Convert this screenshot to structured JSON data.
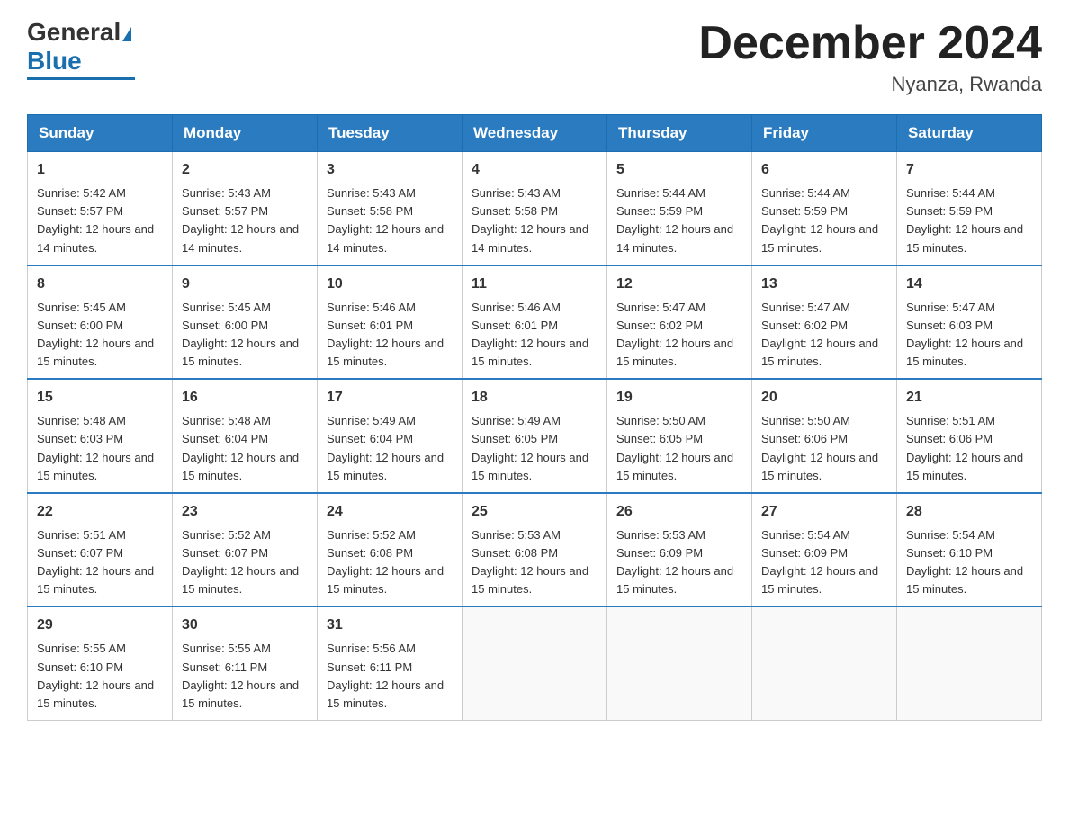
{
  "logo": {
    "general": "General",
    "blue": "Blue"
  },
  "header": {
    "month_year": "December 2024",
    "location": "Nyanza, Rwanda"
  },
  "days_of_week": [
    "Sunday",
    "Monday",
    "Tuesday",
    "Wednesday",
    "Thursday",
    "Friday",
    "Saturday"
  ],
  "weeks": [
    [
      {
        "day": "1",
        "sunrise": "5:42 AM",
        "sunset": "5:57 PM",
        "daylight": "12 hours and 14 minutes."
      },
      {
        "day": "2",
        "sunrise": "5:43 AM",
        "sunset": "5:57 PM",
        "daylight": "12 hours and 14 minutes."
      },
      {
        "day": "3",
        "sunrise": "5:43 AM",
        "sunset": "5:58 PM",
        "daylight": "12 hours and 14 minutes."
      },
      {
        "day": "4",
        "sunrise": "5:43 AM",
        "sunset": "5:58 PM",
        "daylight": "12 hours and 14 minutes."
      },
      {
        "day": "5",
        "sunrise": "5:44 AM",
        "sunset": "5:59 PM",
        "daylight": "12 hours and 14 minutes."
      },
      {
        "day": "6",
        "sunrise": "5:44 AM",
        "sunset": "5:59 PM",
        "daylight": "12 hours and 15 minutes."
      },
      {
        "day": "7",
        "sunrise": "5:44 AM",
        "sunset": "5:59 PM",
        "daylight": "12 hours and 15 minutes."
      }
    ],
    [
      {
        "day": "8",
        "sunrise": "5:45 AM",
        "sunset": "6:00 PM",
        "daylight": "12 hours and 15 minutes."
      },
      {
        "day": "9",
        "sunrise": "5:45 AM",
        "sunset": "6:00 PM",
        "daylight": "12 hours and 15 minutes."
      },
      {
        "day": "10",
        "sunrise": "5:46 AM",
        "sunset": "6:01 PM",
        "daylight": "12 hours and 15 minutes."
      },
      {
        "day": "11",
        "sunrise": "5:46 AM",
        "sunset": "6:01 PM",
        "daylight": "12 hours and 15 minutes."
      },
      {
        "day": "12",
        "sunrise": "5:47 AM",
        "sunset": "6:02 PM",
        "daylight": "12 hours and 15 minutes."
      },
      {
        "day": "13",
        "sunrise": "5:47 AM",
        "sunset": "6:02 PM",
        "daylight": "12 hours and 15 minutes."
      },
      {
        "day": "14",
        "sunrise": "5:47 AM",
        "sunset": "6:03 PM",
        "daylight": "12 hours and 15 minutes."
      }
    ],
    [
      {
        "day": "15",
        "sunrise": "5:48 AM",
        "sunset": "6:03 PM",
        "daylight": "12 hours and 15 minutes."
      },
      {
        "day": "16",
        "sunrise": "5:48 AM",
        "sunset": "6:04 PM",
        "daylight": "12 hours and 15 minutes."
      },
      {
        "day": "17",
        "sunrise": "5:49 AM",
        "sunset": "6:04 PM",
        "daylight": "12 hours and 15 minutes."
      },
      {
        "day": "18",
        "sunrise": "5:49 AM",
        "sunset": "6:05 PM",
        "daylight": "12 hours and 15 minutes."
      },
      {
        "day": "19",
        "sunrise": "5:50 AM",
        "sunset": "6:05 PM",
        "daylight": "12 hours and 15 minutes."
      },
      {
        "day": "20",
        "sunrise": "5:50 AM",
        "sunset": "6:06 PM",
        "daylight": "12 hours and 15 minutes."
      },
      {
        "day": "21",
        "sunrise": "5:51 AM",
        "sunset": "6:06 PM",
        "daylight": "12 hours and 15 minutes."
      }
    ],
    [
      {
        "day": "22",
        "sunrise": "5:51 AM",
        "sunset": "6:07 PM",
        "daylight": "12 hours and 15 minutes."
      },
      {
        "day": "23",
        "sunrise": "5:52 AM",
        "sunset": "6:07 PM",
        "daylight": "12 hours and 15 minutes."
      },
      {
        "day": "24",
        "sunrise": "5:52 AM",
        "sunset": "6:08 PM",
        "daylight": "12 hours and 15 minutes."
      },
      {
        "day": "25",
        "sunrise": "5:53 AM",
        "sunset": "6:08 PM",
        "daylight": "12 hours and 15 minutes."
      },
      {
        "day": "26",
        "sunrise": "5:53 AM",
        "sunset": "6:09 PM",
        "daylight": "12 hours and 15 minutes."
      },
      {
        "day": "27",
        "sunrise": "5:54 AM",
        "sunset": "6:09 PM",
        "daylight": "12 hours and 15 minutes."
      },
      {
        "day": "28",
        "sunrise": "5:54 AM",
        "sunset": "6:10 PM",
        "daylight": "12 hours and 15 minutes."
      }
    ],
    [
      {
        "day": "29",
        "sunrise": "5:55 AM",
        "sunset": "6:10 PM",
        "daylight": "12 hours and 15 minutes."
      },
      {
        "day": "30",
        "sunrise": "5:55 AM",
        "sunset": "6:11 PM",
        "daylight": "12 hours and 15 minutes."
      },
      {
        "day": "31",
        "sunrise": "5:56 AM",
        "sunset": "6:11 PM",
        "daylight": "12 hours and 15 minutes."
      },
      null,
      null,
      null,
      null
    ]
  ]
}
